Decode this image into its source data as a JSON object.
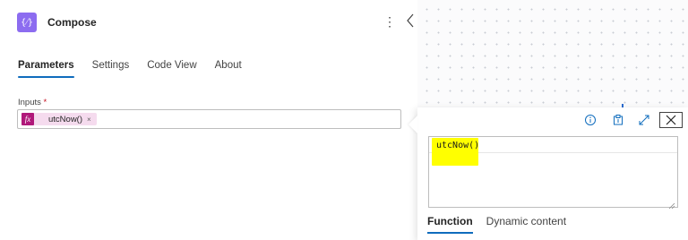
{
  "action": {
    "title": "Compose",
    "icon_glyph": "{⁄}",
    "icon": "compose-icon",
    "accent_color": "#8c6cf0"
  },
  "header": {
    "more_glyph": "⋮",
    "more_icon": "more-vertical-icon",
    "collapse_icon": "chevron-left-icon"
  },
  "tabs": [
    {
      "label": "Parameters",
      "active": true
    },
    {
      "label": "Settings",
      "active": false
    },
    {
      "label": "Code View",
      "active": false
    },
    {
      "label": "About",
      "active": false
    }
  ],
  "inputs": {
    "label": "Inputs",
    "required_mark": "*",
    "token": {
      "fx_glyph": "fx",
      "text": "utcNow()",
      "remove_glyph": "×",
      "color": "#b0187a"
    }
  },
  "expression_editor": {
    "value": "utcNow()",
    "highlight_color": "#ffff00",
    "toolbar_icons": [
      "info-icon",
      "clipboard-icon",
      "expand-icon",
      "close-icon"
    ],
    "tabs": [
      {
        "label": "Function",
        "active": true
      },
      {
        "label": "Dynamic content",
        "active": false
      }
    ]
  }
}
